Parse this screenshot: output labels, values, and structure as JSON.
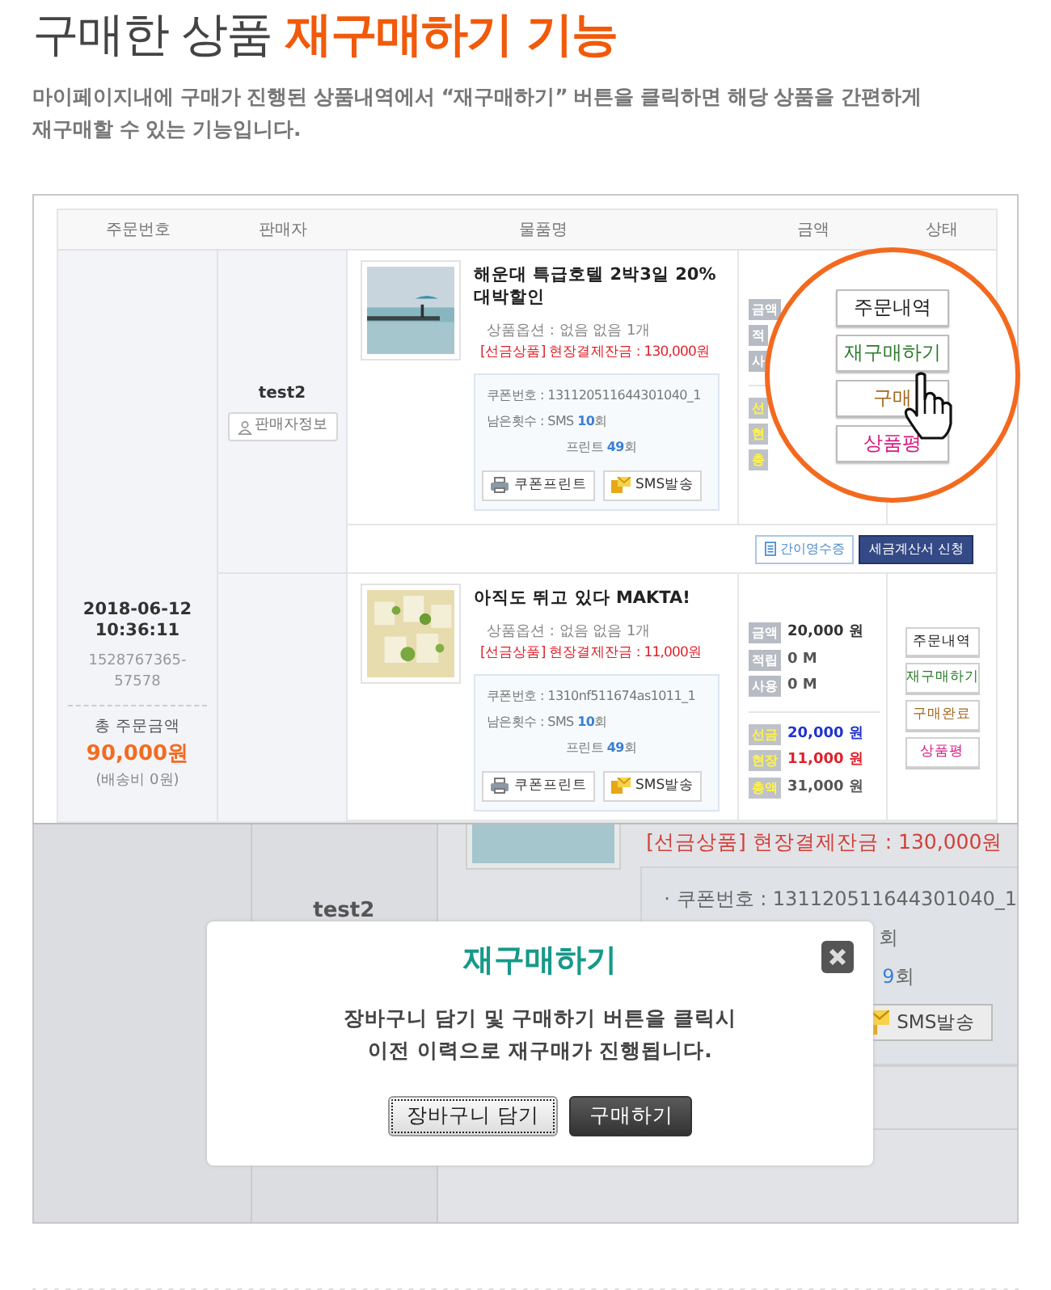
{
  "heading": {
    "lead": "구매한 상품",
    "highlight": "재구매하기 기능"
  },
  "description_lines": [
    "마이페이지내에 구매가 진행된 상품내역에서 “재구매하기” 버튼을 클릭하면 해당 상품을 간편하게",
    "재구매할 수 있는 기능입니다."
  ],
  "order_list": {
    "columns": [
      "주문번호",
      "판매자",
      "물품명",
      "금액",
      "상태"
    ],
    "order": {
      "date": "2018-06-12",
      "time": "10:36:11",
      "number": "1528767365-57578",
      "total_label": "총 주문금액",
      "total": "90,000원",
      "shipping": "(배송비 0원)"
    },
    "seller": {
      "name": "test2",
      "info_button": "판매자정보"
    },
    "items": [
      {
        "name": "해운대 특급호텔 2박3일 20% 대박할인",
        "option": "상품옵션 : 없음 없음 1개",
        "balance": "[선금상품] 현장결제잔금 : 130,000원",
        "coupon_no": "쿠폰번호 : 131120511644301040_1",
        "sms_label": "남은횟수 : SMS",
        "sms_count": "10",
        "sms_unit": "회",
        "print_label": "프린트",
        "print_count": "49",
        "print_unit": "회",
        "coupon_print_button": "쿠폰프린트",
        "sms_button": "SMS발송",
        "amounts": [
          {
            "kind": "basic",
            "label": "금액"
          },
          {
            "kind": "basic",
            "label": "적"
          },
          {
            "kind": "basic",
            "label": "사"
          },
          {
            "kind": "payment",
            "label": "선"
          },
          {
            "kind": "payment",
            "label": "현"
          },
          {
            "kind": "payment",
            "label": "총"
          }
        ],
        "kind": "magnified",
        "status_buttons": [
          {
            "label": "주문내역",
            "kind": "order"
          },
          {
            "label": "재구매하기",
            "kind": "reorder"
          },
          {
            "label": "구매",
            "kind": "complete"
          },
          {
            "label": "상품평",
            "kind": "review"
          }
        ]
      },
      {
        "name": "아직도 뛰고 있다 MAKTA!",
        "option": "상품옵션 : 없음 없음 1개",
        "balance": "[선금상품] 현장결제잔금 : 11,000원",
        "coupon_no": "쿠폰번호 : 1310nf511674as1011_1",
        "sms_label": "남은횟수 : SMS",
        "sms_count": "10",
        "sms_unit": "회",
        "print_label": "프린트",
        "print_count": "49",
        "print_unit": "회",
        "coupon_print_button": "쿠폰프린트",
        "sms_button": "SMS발송",
        "amounts": [
          {
            "kind": "basic",
            "label": "금액",
            "value": "20,000 원",
            "color": "#333333"
          },
          {
            "kind": "basic",
            "label": "적립",
            "value": "0 M",
            "color": "#555555"
          },
          {
            "kind": "basic",
            "label": "사용",
            "value": "0 M",
            "color": "#555555"
          },
          {
            "kind": "payment",
            "label": "선금",
            "value": "20,000 원",
            "color": "#2233cc"
          },
          {
            "kind": "payment",
            "label": "현장",
            "value": "11,000 원",
            "color": "#e0202a"
          },
          {
            "kind": "payment",
            "label": "총액",
            "value": "31,000 원",
            "color": "#555555"
          }
        ],
        "kind": "normal",
        "status_buttons": [
          {
            "label": "주문내역",
            "kind": "order"
          },
          {
            "label": "재구매하기",
            "kind": "reorder"
          },
          {
            "label": "구매완료",
            "kind": "complete"
          },
          {
            "label": "상품평",
            "kind": "review"
          }
        ]
      }
    ],
    "receipt_buttons": [
      {
        "label": "간이영수증",
        "kind": "receipt"
      },
      {
        "label": "세금계산서 신청",
        "kind": "tax"
      }
    ]
  },
  "modal_screen": {
    "background": {
      "seller": "test2",
      "balance": "[선금상품] 현장결제잔금 : 130,000원",
      "coupon_no": "· 쿠폰번호 : 131120511644301040_1",
      "sms_unit": "회",
      "print_count": "9",
      "print_unit": "회",
      "sms_button": "SMS발송"
    },
    "dialog": {
      "title": "재구매하기",
      "message_lines": [
        "장바구니 담기 및 구매하기 버튼을 클릭시",
        "이전 이력으로 재구매가 진행됩니다."
      ],
      "buttons": [
        {
          "label": "장바구니 담기",
          "kind": "light",
          "selected": true
        },
        {
          "label": "구매하기",
          "kind": "dark",
          "selected": false
        }
      ]
    }
  }
}
